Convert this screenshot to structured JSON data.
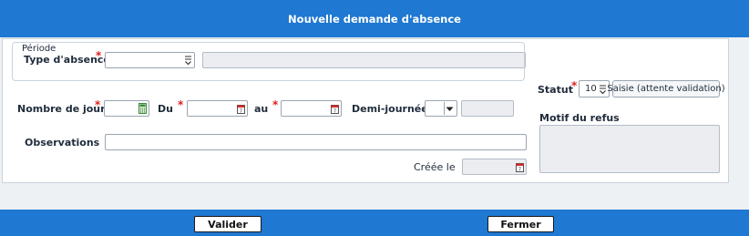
{
  "dialog": {
    "title": "Nouvelle demande d'absence"
  },
  "form": {
    "type_absence": {
      "label": "Type d'absence",
      "value": "",
      "description": ""
    },
    "periode": {
      "legend": "Période",
      "nombre_jours_label": "Nombre de jours",
      "nombre_jours_value": "",
      "du_label": "Du",
      "du_value": "",
      "au_label": "au",
      "au_value": "",
      "demi_journee_label": "Demi-journée",
      "demi_journee_value": "",
      "demi_journee_extra": ""
    },
    "observations": {
      "label": "Observations",
      "value": ""
    },
    "creee_le": {
      "label": "Créée le",
      "value": ""
    },
    "statut": {
      "label": "Statut",
      "code": "10",
      "text": "Saisie (attente validation)"
    },
    "motif_refus": {
      "label": "Motif du refus",
      "value": ""
    },
    "required_mark": "*"
  },
  "footer": {
    "valider_label": "Valider",
    "fermer_label": "Fermer"
  },
  "colors": {
    "accent": "#1f78d1",
    "required": "#e02020",
    "readonly_bg": "#ebedf0"
  },
  "icons": {
    "dropdown": "combo-dropdown-icon",
    "calendar": "calendar-icon",
    "calculator": "calculator-icon"
  }
}
